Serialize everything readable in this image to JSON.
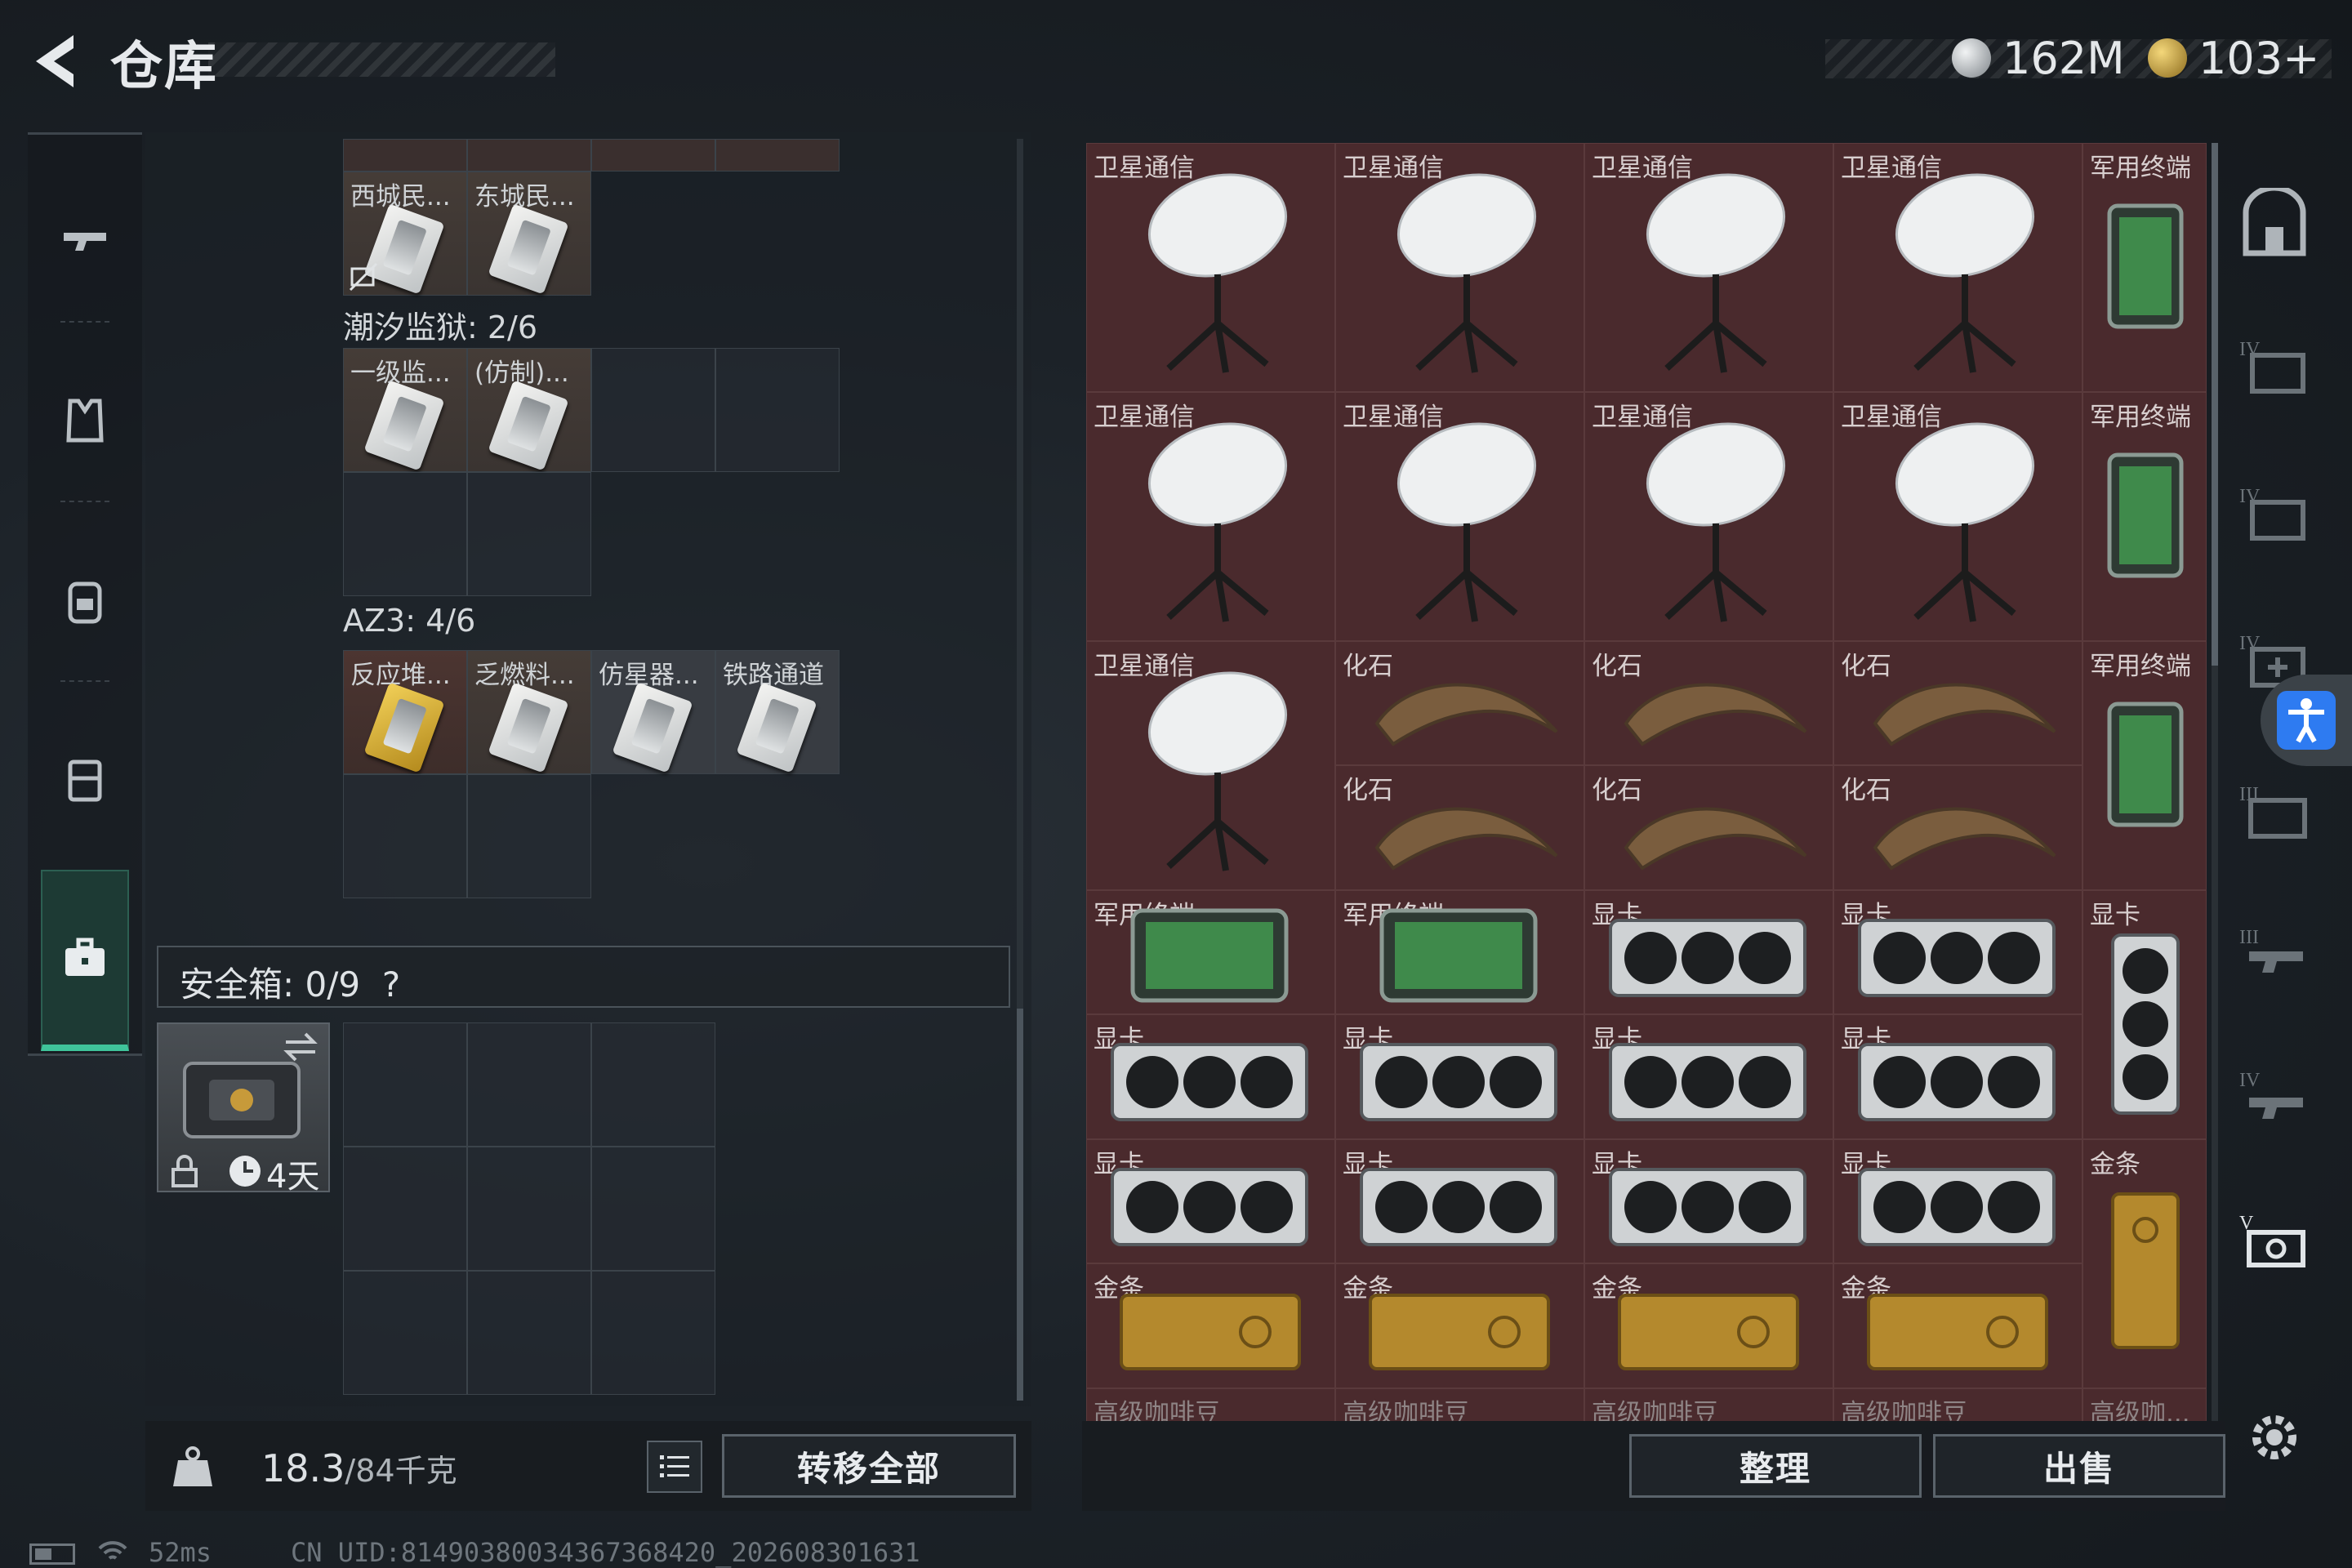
{
  "header": {
    "title": "仓库",
    "back_icon": "back-arrow-icon"
  },
  "currency": [
    {
      "icon": "silver-coin-icon",
      "value": "162M",
      "color": "#b9bec2"
    },
    {
      "icon": "gold-triangle-coin-icon",
      "value": "103+",
      "color": "#c9a64a"
    }
  ],
  "left_nav": [
    {
      "icon": "gun-icon",
      "active": false
    },
    {
      "icon": "armor-vest-icon",
      "active": false
    },
    {
      "icon": "backpack-icon",
      "active": false
    },
    {
      "icon": "chest-rig-icon",
      "active": false
    },
    {
      "icon": "toolbox-icon",
      "active": true
    }
  ],
  "keycards": {
    "top_row_labels": [
      "西城民...",
      "东城民..."
    ],
    "prison_section": {
      "label": "潮汐监狱: 2/6",
      "items": [
        "一级监...",
        "(仿制)..."
      ]
    },
    "az3_section": {
      "label": "AZ3: 4/6",
      "items": [
        "反应堆...",
        "乏燃料...",
        "仿星器...",
        "铁路通道"
      ]
    }
  },
  "safe_box": {
    "label": "安全箱: 0/9",
    "help": "?",
    "time_left": "4天"
  },
  "bottom_left": {
    "weight_current": "18.3",
    "weight_max": "/84千克",
    "transfer_all": "转移全部"
  },
  "inventory": {
    "rows": [
      [
        "卫星通信",
        "卫星通信",
        "卫星通信",
        "卫星通信",
        "军用终端"
      ],
      [
        "卫星通信",
        "卫星通信",
        "卫星通信",
        "卫星通信",
        "军用终端"
      ],
      [
        "卫星通信",
        "化石",
        "化石",
        "化石",
        "军用终端"
      ],
      [
        "",
        "化石",
        "化石",
        "化石",
        ""
      ],
      [
        "军用终端",
        "军用终端",
        "显卡",
        "显卡",
        "显卡"
      ],
      [
        "显卡",
        "显卡",
        "显卡",
        "显卡",
        ""
      ],
      [
        "显卡",
        "显卡",
        "显卡",
        "显卡",
        "金条"
      ],
      [
        "金条",
        "金条",
        "金条",
        "金条",
        ""
      ],
      [
        "高级咖啡豆",
        "高级咖啡豆",
        "高级咖啡豆",
        "高级咖啡豆",
        "高级咖..."
      ]
    ]
  },
  "bottom_right": {
    "sort": "整理",
    "sell": "出售"
  },
  "status_bar": {
    "ping": "52ms",
    "uid": "CN UID:81490380034367368420_202608301631"
  }
}
